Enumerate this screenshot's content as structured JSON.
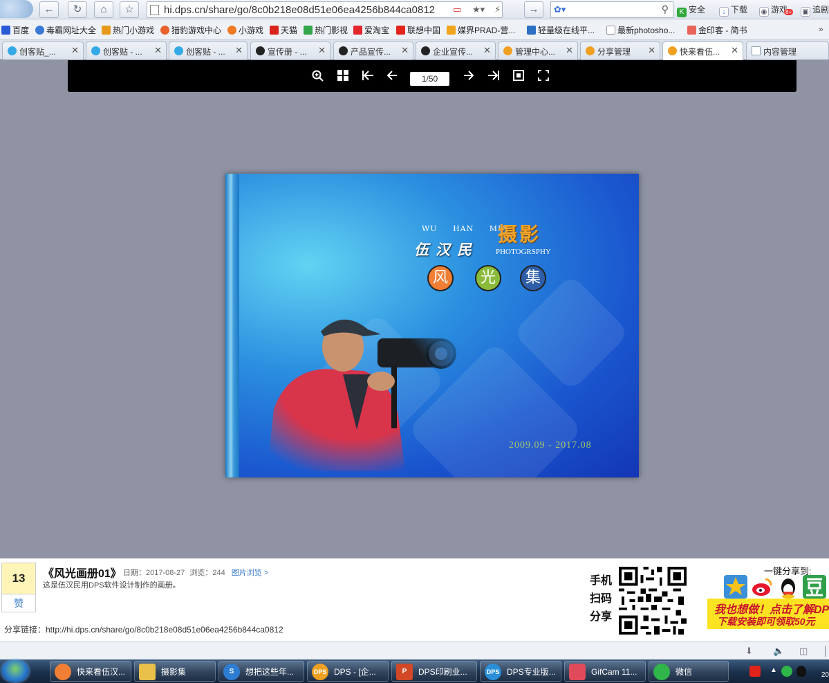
{
  "browser": {
    "url": "hi.dps.cn/share/go/8c0b218e08d51e06ea4256b844ca0812",
    "right_tools": {
      "security": "安全",
      "download": "下载",
      "games": "游戏",
      "games_badge": "8+",
      "more": "追剧"
    }
  },
  "bookmarks": [
    {
      "label": "百度",
      "color": "#2a5bd7"
    },
    {
      "label": "毒霸网址大全",
      "color": "#3a78d8"
    },
    {
      "label": "热门小游戏",
      "color": "#e79a1b"
    },
    {
      "label": "猎豹游戏中心",
      "color": "#e8632b"
    },
    {
      "label": "小游戏",
      "color": "#f07a22"
    },
    {
      "label": "天猫",
      "color": "#d9241c"
    },
    {
      "label": "热门影视",
      "color": "#34a64b"
    },
    {
      "label": "爱淘宝",
      "color": "#e3272d"
    },
    {
      "label": "联想中国",
      "color": "#e2231a"
    },
    {
      "label": "媒界PRAD-营...",
      "color": "#f1a51c"
    },
    {
      "label": "轻量级在线平...",
      "color": "#2c6fc4"
    },
    {
      "label": "最新photosho...",
      "color": "#999999"
    },
    {
      "label": "金印客 - 简书",
      "color": "#e8645a"
    }
  ],
  "tabs": [
    {
      "label": "创客贴_...",
      "color": "#35a8e6"
    },
    {
      "label": "创客贴 - ...",
      "color": "#35a8e6"
    },
    {
      "label": "创客贴 - ...",
      "color": "#35a8e6"
    },
    {
      "label": "宣传册 - ...",
      "color": "#222222"
    },
    {
      "label": "产品宣传...",
      "color": "#222222"
    },
    {
      "label": "企业宣传...",
      "color": "#222222"
    },
    {
      "label": "管理中心...",
      "color": "#f0a020"
    },
    {
      "label": "分享管理",
      "color": "#f0a020"
    },
    {
      "label": "快来看伍...",
      "color": "#f0a020"
    },
    {
      "label": "内容管理",
      "color": "#8899aa"
    }
  ],
  "viewer": {
    "page_indicator": "1/50"
  },
  "book_cover": {
    "name_latin": "WU HAN MIN",
    "name_cn": "伍汉民",
    "title_cn": "摄影",
    "title_en": "PHOTOGRSPHY",
    "circles": [
      {
        "char": "风",
        "color": "#f07f35"
      },
      {
        "char": "光",
        "color": "#8bbb3a"
      },
      {
        "char": "集",
        "color": "#2f5ea8"
      }
    ],
    "dates": "2009.09 - 2017.08"
  },
  "album": {
    "like_count": "13",
    "like_label": "赞",
    "title": "《风光画册01》",
    "date_label": "日期：2017-08-27",
    "views_label": "浏览：244",
    "link_label": "图片浏览 >",
    "description": "这是伍汉民用DPS软件设计制作的画册。",
    "share_link": "分享链接：http://hi.dps.cn/share/go/8c0b218e08d51e06ea4256b844ca0812",
    "scan_label": "手机扫码分享",
    "share_to_label": "一键分享到:",
    "promo_line1": "我也想做！点击了解DPS",
    "promo_line2": "下载安装即可领取50元"
  },
  "taskbar": [
    {
      "label": "快来看伍汉...",
      "color": "#f07f35",
      "icon": ""
    },
    {
      "label": "摄影集",
      "color": "#e8c04a",
      "icon": ""
    },
    {
      "label": "想把这些年...",
      "color": "#2d7dd2",
      "icon": "S"
    },
    {
      "label": "DPS - [企...",
      "color": "#f0a020",
      "icon": "DPS"
    },
    {
      "label": "DPS印刷业...",
      "color": "#d24726",
      "icon": "P"
    },
    {
      "label": "DPS专业版...",
      "color": "#2a8fd8",
      "icon": "DPS"
    },
    {
      "label": "GifCam 11...",
      "color": "#e04a5a",
      "icon": ""
    },
    {
      "label": "微信",
      "color": "#2fb54a",
      "icon": ""
    }
  ],
  "clock_partial": "20"
}
